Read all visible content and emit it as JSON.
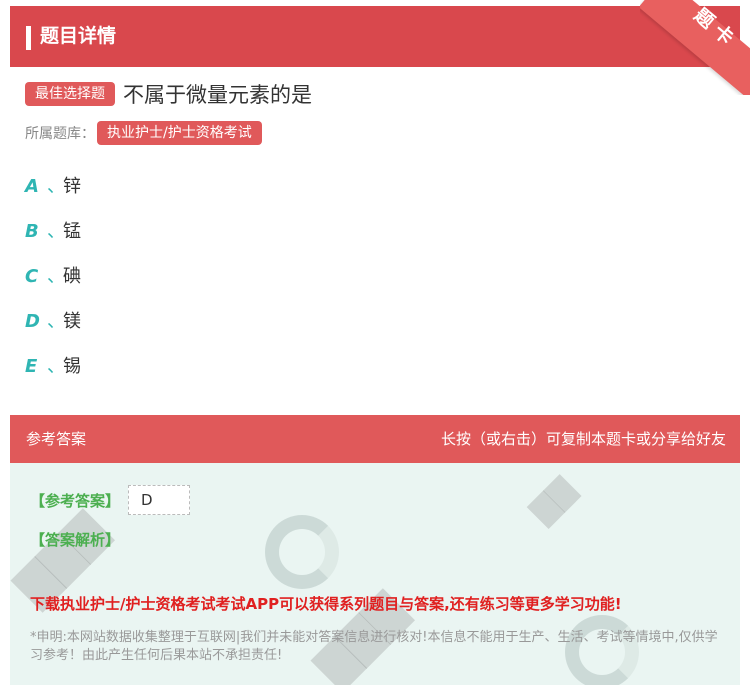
{
  "header": {
    "title": "题目详情",
    "ribbon": "题卡"
  },
  "question": {
    "type_label": "最佳选择题",
    "text": "不属于微量元素的是",
    "library_label": "所属题库：",
    "library_tag": "执业护士/护士资格考试"
  },
  "options": [
    {
      "letter": "A",
      "sep": "、",
      "text": "锌"
    },
    {
      "letter": "B",
      "sep": "、",
      "text": "锰"
    },
    {
      "letter": "C",
      "sep": "、",
      "text": "碘"
    },
    {
      "letter": "D",
      "sep": "、",
      "text": "镁"
    },
    {
      "letter": "E",
      "sep": "、",
      "text": "锡"
    }
  ],
  "answer_section": {
    "title": "参考答案",
    "hint": "长按（或右击）可复制本题卡或分享给好友",
    "answer_label": "【参考答案】",
    "answer_value": "D",
    "analysis_label": "【答案解析】",
    "promo": "下载执业护士/护士资格考试考试APP可以获得系列题目与答案,还有练习等更多学习功能!",
    "disclaimer": "*申明:本网站数据收集整理于互联网|我们并未能对答案信息进行核对!本信息不能用于生产、生活、考试等情境中,仅供学习参考！由此产生任何后果本站不承担责任!"
  },
  "colors": {
    "primary_red": "#d9484d",
    "option_teal": "#2fb5b3",
    "answer_green": "#4caf50",
    "promo_red": "#e02020",
    "answer_bg": "#eaf5f2"
  }
}
